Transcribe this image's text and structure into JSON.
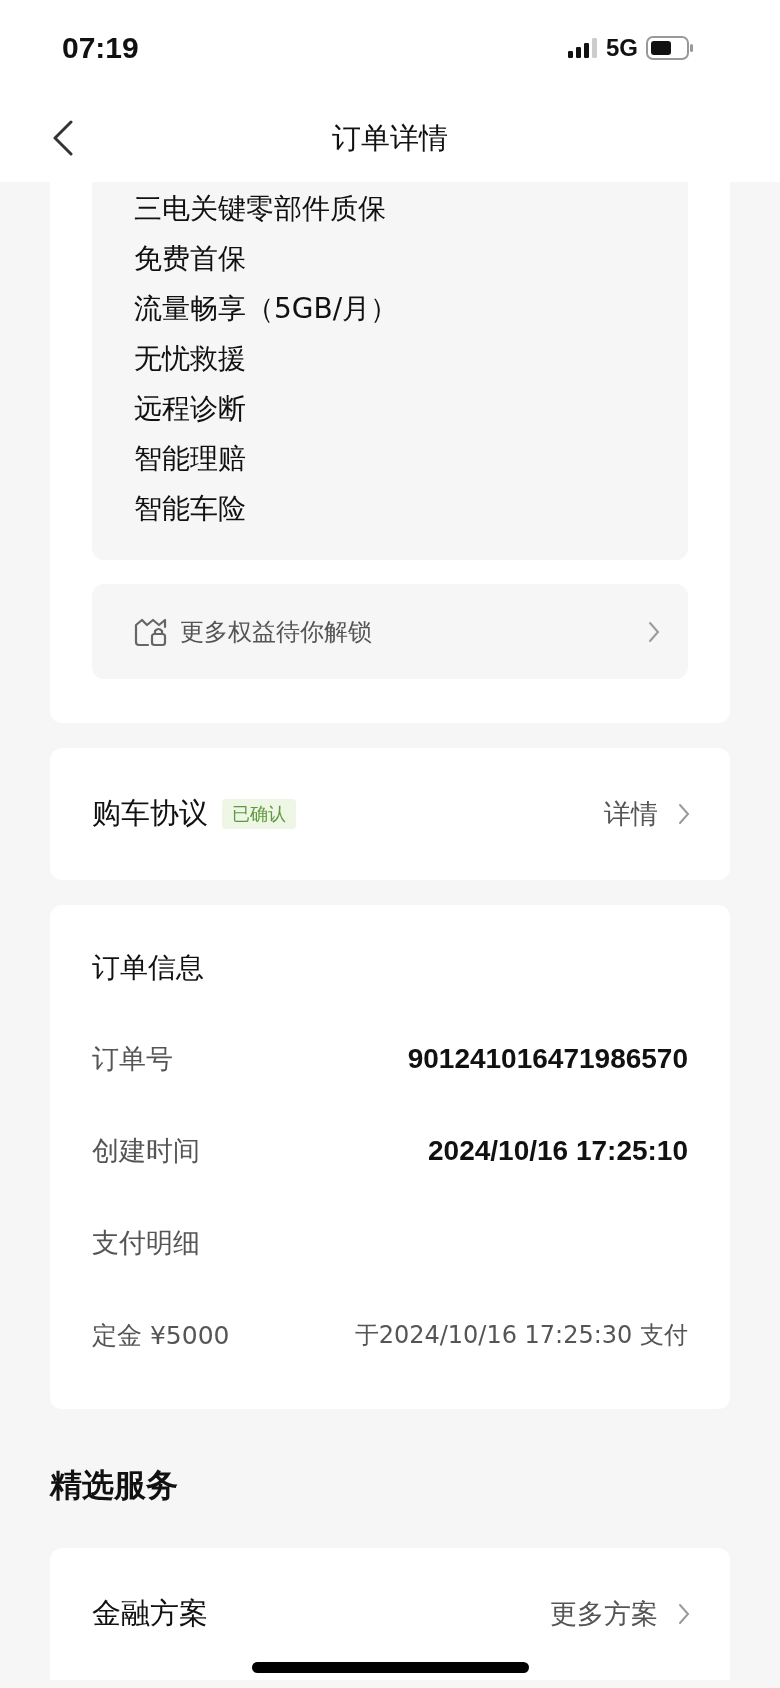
{
  "status_bar": {
    "time": "07:19",
    "network": "5G"
  },
  "nav": {
    "title": "订单详情"
  },
  "benefits": {
    "items": [
      "三电关键零部件质保",
      "免费首保",
      "流量畅享（5GB/月）",
      "无忧救援",
      "远程诊断",
      "智能理赔",
      "智能车险"
    ],
    "unlock": {
      "label": "更多权益待你解锁"
    }
  },
  "agreement": {
    "title": "购车协议",
    "badge": "已确认",
    "link": "详情"
  },
  "order_info": {
    "title": "订单信息",
    "rows": [
      {
        "label": "订单号",
        "value": "901241016471986570"
      },
      {
        "label": "创建时间",
        "value": "2024/10/16 17:25:10"
      },
      {
        "label": "支付明细",
        "value": null
      },
      {
        "label": "定金 ¥5000",
        "value": "于2024/10/16 17:25:30 支付",
        "kind": "payment"
      }
    ]
  },
  "services": {
    "title": "精选服务",
    "cards": [
      {
        "title": "金融方案",
        "link": "更多方案"
      }
    ]
  }
}
